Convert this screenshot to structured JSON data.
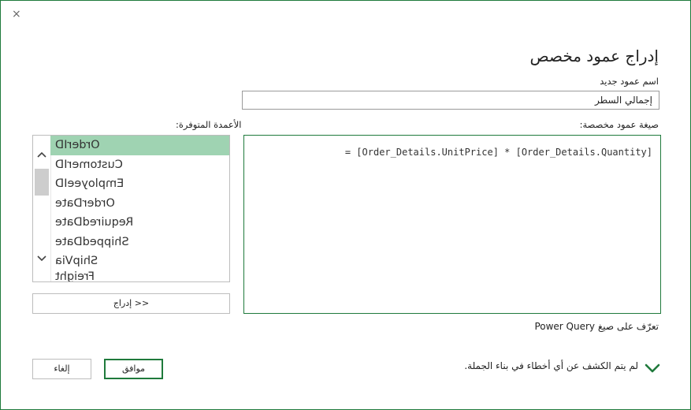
{
  "dialog": {
    "close_glyph": "×",
    "title": "إدراج عمود مخصص"
  },
  "new_column": {
    "label": "اسم عمود جديد",
    "value": "إجمالي السطر"
  },
  "formula": {
    "label": "صيغة عمود مخصصة:",
    "value": "= [Order_Details.UnitPrice] * [Order_Details.Quantity]"
  },
  "available_columns": {
    "label": "الأعمدة المتوفرة:",
    "items": [
      "OrderID",
      "CustomerID",
      "EmployeeID",
      "OrderDate",
      "RequiredDate",
      "ShippedDate",
      "ShipVia",
      "Freight"
    ],
    "selected_index": 0
  },
  "insert_button": "<< إدراج",
  "learn_link": "تعرّف على صيغ Power Query",
  "status": "لم يتم الكشف عن أي أخطاء في بناء الجملة.",
  "ok_button": "موافق",
  "cancel_button": "إلغاء",
  "colors": {
    "accent": "#1f7a3c",
    "selection": "#9fd3b2"
  }
}
